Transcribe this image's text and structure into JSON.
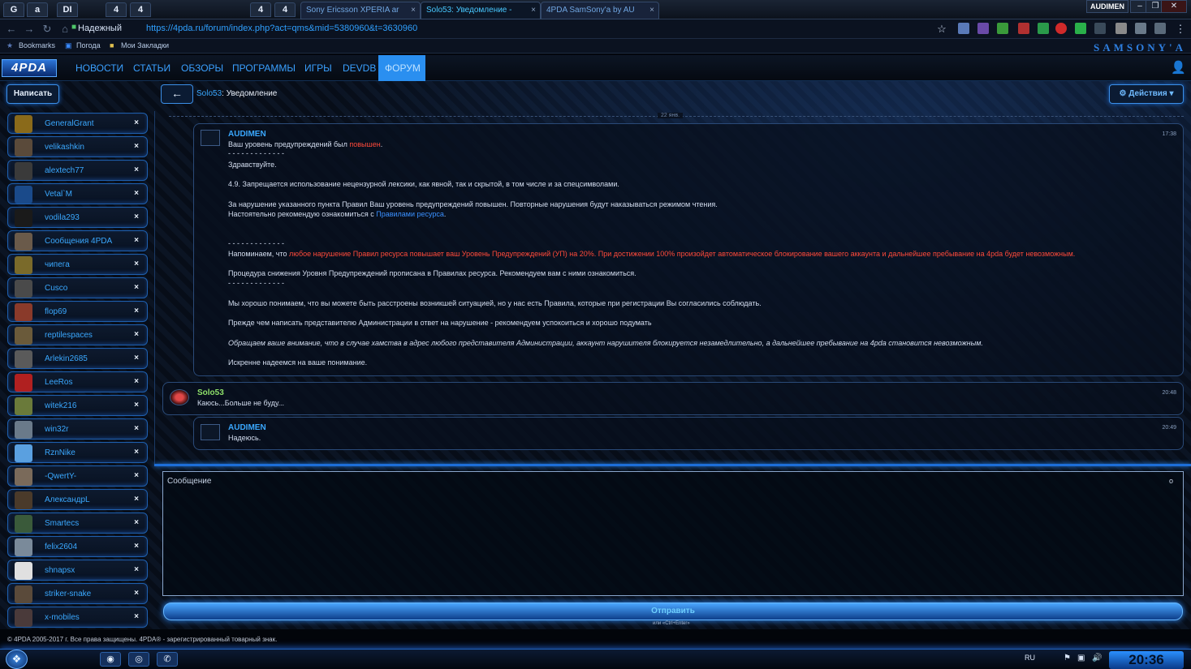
{
  "browser": {
    "pinned_tabs": [
      "G",
      "a",
      "DI",
      "4",
      "4",
      "4",
      "4"
    ],
    "tabs": [
      {
        "label": "Sony Ericsson XPERIA ar",
        "active": false
      },
      {
        "label": "Solo53: Уведомление -",
        "active": true
      },
      {
        "label": "4PDA SamSony'a by AU",
        "active": false
      }
    ],
    "tab_close": "×",
    "profile_name": "AUDIMEN",
    "window_buttons": [
      "–",
      "❐",
      "✕"
    ],
    "secure_label": "Надежный",
    "url": "https://4pda.ru/forum/index.php?act=qms&mid=5380960&t=3630960",
    "bookmarks": [
      "Bookmarks",
      "Погода",
      "Мои Закладки"
    ],
    "theme_logo": "SAMSONY'A",
    "icons": [
      "back-icon",
      "forward-icon",
      "reload-icon",
      "home-icon",
      "lock-icon",
      "star-icon",
      "menu-icon"
    ]
  },
  "site": {
    "logo": "4PDA",
    "nav": [
      "НОВОСТИ",
      "СТАТЬИ",
      "ОБЗОРЫ",
      "ПРОГРАММЫ",
      "ИГРЫ",
      "DEVDB",
      "ФОРУМ"
    ],
    "active_nav": "ФОРУМ",
    "user_icon": "user-icon"
  },
  "toolbar": {
    "write_button": "Написать",
    "back_icon": "←",
    "thread_user": "Solo53",
    "thread_title": ": Уведомление",
    "actions_button": "⚙ Действия ▾"
  },
  "contacts": {
    "close_label": "×",
    "items": [
      {
        "name": "GeneralGrant",
        "color": "#8a6a1a"
      },
      {
        "name": "velikashkin",
        "color": "#5a4a3a"
      },
      {
        "name": "alextech77",
        "color": "#3a3a3a"
      },
      {
        "name": "Vetal`M",
        "color": "#1a4a8a"
      },
      {
        "name": "vodila293",
        "color": "#1a1a1a"
      },
      {
        "name": "Сообщения 4PDA",
        "color": "#6a5a4a"
      },
      {
        "name": "чипега",
        "color": "#7a6a2a"
      },
      {
        "name": "Cusco",
        "color": "#4a4a4a"
      },
      {
        "name": "flop69",
        "color": "#8a3a2a"
      },
      {
        "name": "reptilespaces",
        "color": "#6a5a3a"
      },
      {
        "name": "Arlekin2685",
        "color": "#5a5a5a"
      },
      {
        "name": "LeeRos",
        "color": "#b02020"
      },
      {
        "name": "witek216",
        "color": "#6a7a3a"
      },
      {
        "name": "win32r",
        "color": "#6a7a8a"
      },
      {
        "name": "RznNike",
        "color": "#5aa0e0"
      },
      {
        "name": "-QwertY-",
        "color": "#7a6a5a"
      },
      {
        "name": "АлександрL",
        "color": "#4a3a2a"
      },
      {
        "name": "Smartecs",
        "color": "#3a5a3a"
      },
      {
        "name": "felix2604",
        "color": "#7a8a9a"
      },
      {
        "name": "shnapsx",
        "color": "#e0e0e0"
      },
      {
        "name": "striker-snake",
        "color": "#5a4a3a"
      },
      {
        "name": "x-mobiles",
        "color": "#4a3a3a"
      }
    ]
  },
  "chat": {
    "date": "22 янв.",
    "messages": [
      {
        "author": "AUDIMEN",
        "time": "17:38",
        "intro": "Ваш уровень предупреждений был ",
        "intro_red": "повышен",
        "intro_end": ".",
        "sep1": "- - - - - - - - - - - - -",
        "greeting": "Здравствуйте.",
        "rule": "4.9. Запрещается использование нецензурной лексики, как явной, так и скрытой, в том числе и за спецсимволами.",
        "violation": "За нарушение указанного пункта Правил Ваш уровень предупреждений повышен. Повторные нарушения будут наказываться режимом чтения.",
        "recommend": "Настоятельно рекомендую ознакомиться с ",
        "recommend_link": "Правилами ресурса",
        "recommend_end": ".",
        "sep2": "- - - - - - - - - - - - -",
        "remind": "Напоминаем, что ",
        "remind_red": "любое нарушение Правил ресурса повышает ваш Уровень Предупреждений (УП) на 20%. При достижении 100% произойдет автоматическое блокирование вашего аккаунта и дальнейшее пребывание на 4pda будет невозможным.",
        "procedure": "Процедура снижения Уровня Предупреждений прописана в Правилах ресурса. Рекомендуем вам с ними ознакомиться.",
        "sep3": "- - - - - - - - - - - - -",
        "understand": "Мы хорошо понимаем, что вы можете быть расстроены возникшей ситуацией, но у нас есть Правила, которые при регистрации Вы согласились соблюдать.",
        "before": "Прежде чем написать представителю Администрации в ответ на нарушение - рекомендуем успокоиться и хорошо подумать",
        "attention": "Обращаем ваше внимание, что в случае хамства в адрес любого представителя Администрации, аккаунт нарушителя блокируется незамедлительно, а дальнейшее пребывание на 4pda становится невозможным.",
        "hope": "Искренне надеемся на ваше понимание."
      },
      {
        "author": "Solo53",
        "time": "20:48",
        "text": "Каюсь...Больше не буду..."
      },
      {
        "author": "AUDIMEN",
        "time": "20:49",
        "text": "Надеюсь."
      }
    ]
  },
  "composer": {
    "placeholder": "Сообщение",
    "icon": "o",
    "send_button": "Отправить",
    "send_hint": "или «Ctrl+Enter»"
  },
  "footer": {
    "text": "© 4PDA 2005-2017 г. Все права защищены. 4PDA® - зарегистрированный товарный знак."
  },
  "taskbar": {
    "start": "❖",
    "apps": [
      "◉",
      "◎",
      "✆"
    ],
    "lang": "RU",
    "clock": "20:36"
  },
  "colors": {
    "accent": "#3aa8ff",
    "warning": "#ff4a3a",
    "nav_active": "#2a8ff0"
  }
}
